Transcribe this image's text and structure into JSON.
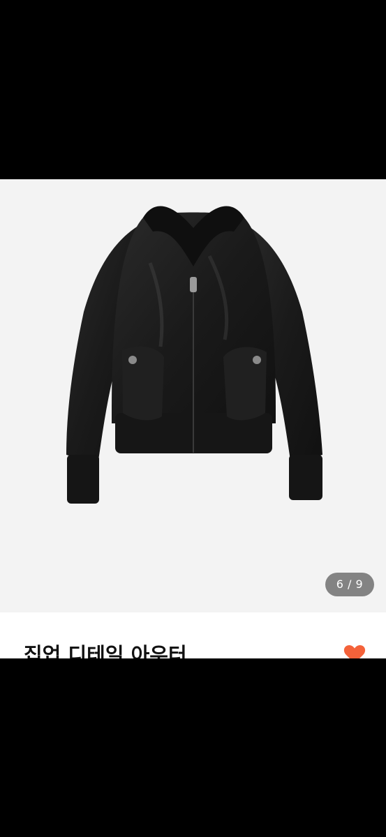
{
  "gallery": {
    "counter": "6 / 9"
  },
  "product": {
    "title": "집업 디테일 아우터",
    "liked": true
  },
  "colors": {
    "photo_background": "#f3f3f3",
    "heart": "#f4623a",
    "jacket": "#1b1b1b"
  },
  "icons": {
    "like": "heart-icon"
  }
}
